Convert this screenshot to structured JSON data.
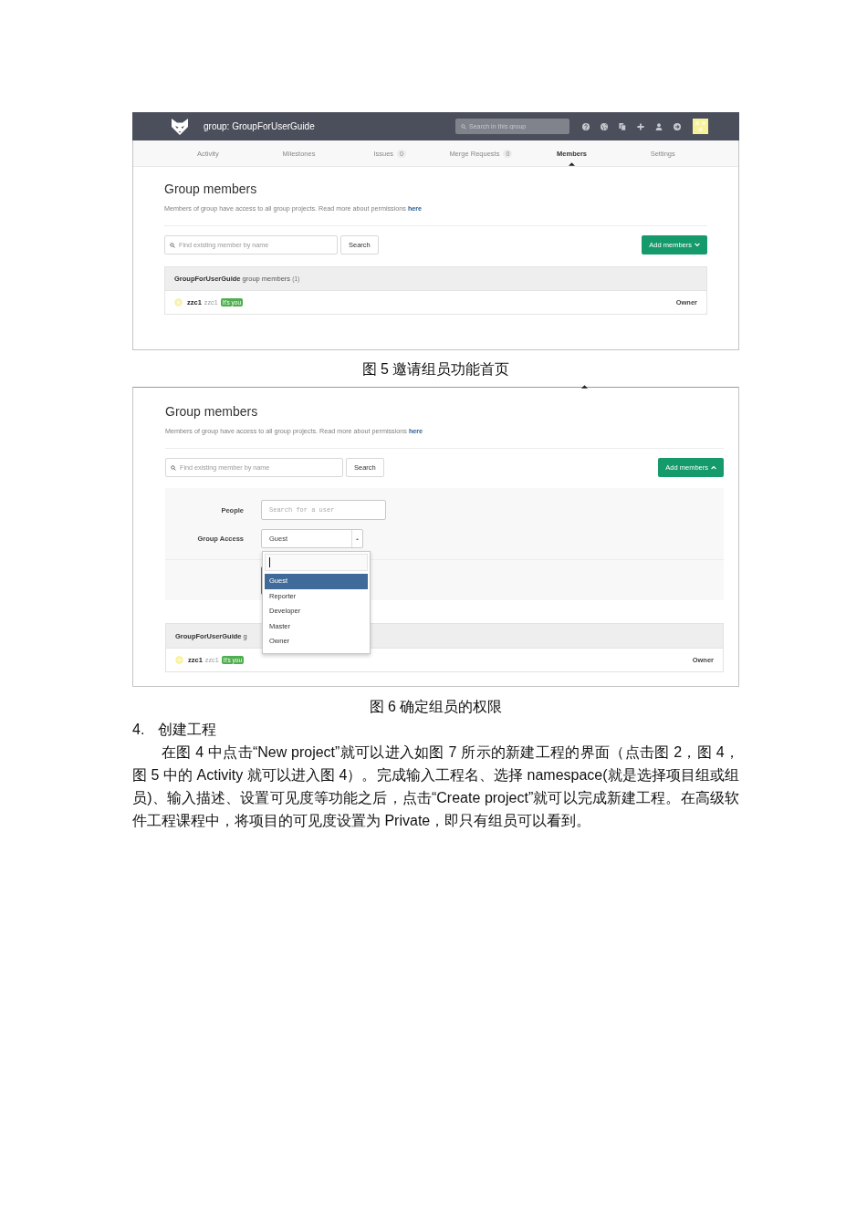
{
  "figures": [
    {
      "screenshot": {
        "header": {
          "title": "group: GroupForUserGuide",
          "search_placeholder": "Search in this group"
        },
        "tabs": [
          {
            "label": "Activity",
            "selected": false
          },
          {
            "label": "Milestones",
            "selected": false
          },
          {
            "label": "Issues",
            "count": "0",
            "selected": false
          },
          {
            "label": "Merge Requests",
            "count": "0",
            "selected": false
          },
          {
            "label": "Members",
            "selected": true
          },
          {
            "label": "Settings",
            "selected": false
          }
        ],
        "heading": "Group members",
        "description": "Members of group have access to all group projects. Read more about permissions",
        "description_link": "here",
        "member_search": {
          "placeholder": "Find existing member by name",
          "button": "Search"
        },
        "add_button": {
          "label": "Add members",
          "expanded": false
        },
        "members_panel": {
          "group_name": "GroupForUserGuide",
          "suffix": "group members",
          "count": "(1)",
          "members": [
            {
              "name": "zzc1",
              "username": "zzc1",
              "badge": "It's you",
              "role": "Owner"
            }
          ]
        }
      },
      "caption": "图 5 邀请组员功能首页"
    },
    {
      "screenshot": {
        "tab_pointer": true,
        "heading": "Group members",
        "description": "Members of group have access to all group projects. Read more about permissions",
        "description_link": "here",
        "member_search": {
          "placeholder": "Find existing member by name",
          "button": "Search"
        },
        "add_button": {
          "label": "Add members",
          "expanded": true
        },
        "add_form": {
          "people": {
            "label": "People",
            "placeholder": "Search for a user"
          },
          "access": {
            "label": "Group Access",
            "value": "Guest",
            "dropdown": {
              "open": true,
              "options": [
                {
                  "label": "Guest",
                  "selected": true
                },
                {
                  "label": "Reporter",
                  "selected": false
                },
                {
                  "label": "Developer",
                  "selected": false
                },
                {
                  "label": "Master",
                  "selected": false
                },
                {
                  "label": "Owner",
                  "selected": false
                }
              ]
            }
          },
          "covered_button": true
        },
        "members_panel": {
          "group_name": "GroupForUserGuide",
          "suffix": "g",
          "members": [
            {
              "name": "zzc1",
              "username": "zzc1",
              "badge": "It's you",
              "role": "Owner"
            }
          ]
        }
      },
      "caption": "图 6 确定组员的权限"
    }
  ],
  "section": {
    "number": "4.",
    "title": "创建工程"
  },
  "paragraph": "在图 4 中点击“New project”就可以进入如图 7 所示的新建工程的界面（点击图 2，图 4，图 5 中的 Activity 就可以进入图 4）。完成输入工程名、选择 namespace(就是选择项目组或组员)、输入描述、设置可见度等功能之后，点击“Create project”就可以完成新建工程。在高级软件工程课程中，将项目的可见度设置为 Private，即只有组员可以看到。"
}
